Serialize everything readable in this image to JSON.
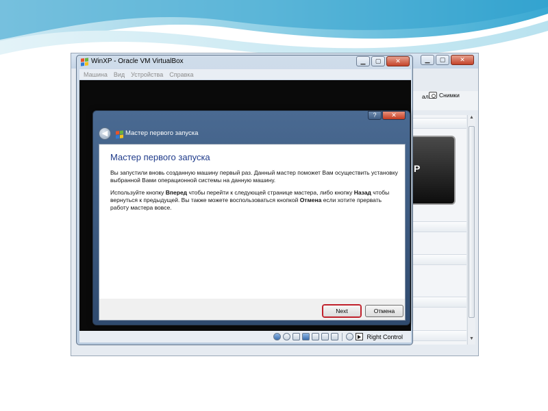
{
  "manager": {
    "toolbar_partial": "али",
    "snapshots_label": "Снимки",
    "preview_partial": "P"
  },
  "vm_window": {
    "title": "WinXP - Oracle VM VirtualBox",
    "menu": [
      "Машина",
      "Вид",
      "Устройства",
      "Справка"
    ],
    "status": {
      "host_key": "Right Control"
    }
  },
  "wizard": {
    "window_title": "Мастер первого запуска",
    "heading": "Мастер первого запуска",
    "paragraph1": "Вы запустили вновь созданную машину первый раз. Данный мастер поможет Вам осуществить установку выбранной Вами операционной системы на данную машину.",
    "p2_part1": "Используйте кнопку ",
    "p2_bold1": "Вперед",
    "p2_part2": " чтобы перейти к следующей странице мастера, либо кнопку ",
    "p2_bold2": "Назад",
    "p2_part3": " чтобы вернуться к предыдущей. Вы также можете воспользоваться кнопкой ",
    "p2_bold3": "Отмена",
    "p2_part4": " если хотите прервать работу мастера вовсе.",
    "next_label": "Next",
    "cancel_label": "Отмена"
  },
  "colors": {
    "heading": "#1e3a8a",
    "next_highlight": "#c0202a"
  }
}
